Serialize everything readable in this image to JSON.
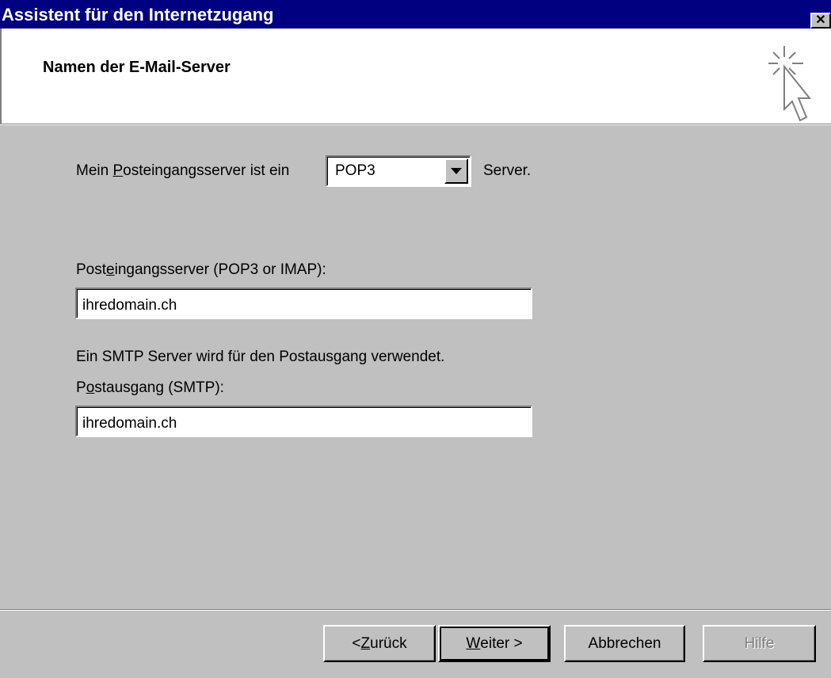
{
  "window": {
    "title": "Assistent für den Internetzugang",
    "close_glyph": "✕"
  },
  "header": {
    "title": "Namen der E-Mail-Server",
    "icon": "wizard-cursor-icon"
  },
  "form": {
    "server_type_prefix_1": "Mein ",
    "server_type_prefix_accel": "P",
    "server_type_prefix_2": "osteingangsserver ist ein",
    "server_type_value": "POP3",
    "server_type_suffix": "Server.",
    "incoming_label_1": "Post",
    "incoming_label_accel": "e",
    "incoming_label_2": "ingangsserver (POP3 or IMAP):",
    "incoming_value": "ihredomain.ch",
    "smtp_note": "Ein SMTP Server wird für den Postausgang verwendet.",
    "outgoing_label_1": "P",
    "outgoing_label_accel": "o",
    "outgoing_label_2": "stausgang (SMTP):",
    "outgoing_value": "ihredomain.ch"
  },
  "buttons": {
    "back_1": "< ",
    "back_accel": "Z",
    "back_2": "urück",
    "next_accel": "W",
    "next_2": "eiter >",
    "cancel": "Abbrechen",
    "help": "Hilfe"
  }
}
